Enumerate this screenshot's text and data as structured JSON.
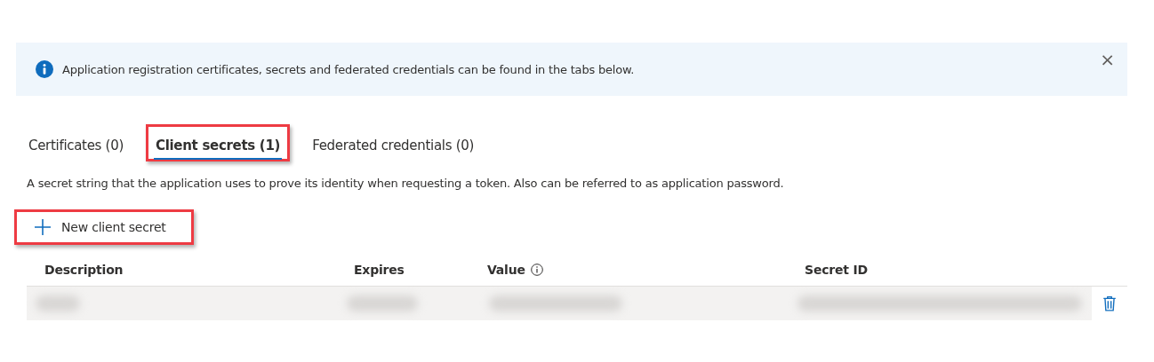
{
  "banner": {
    "message": "Application registration certificates, secrets and federated credentials can be found in the tabs below.",
    "close": "×"
  },
  "tabs": [
    {
      "label": "Certificates (0)",
      "selected": false,
      "highlighted": false
    },
    {
      "label": "Client secrets (1)",
      "selected": true,
      "highlighted": true
    },
    {
      "label": "Federated credentials (0)",
      "selected": false,
      "highlighted": false
    }
  ],
  "description": "A secret string that the application uses to prove its identity when requesting a token. Also can be referred to as application password.",
  "new_button": {
    "label": "New client secret",
    "highlighted": true
  },
  "table": {
    "columns": [
      {
        "label": "Description",
        "info": false
      },
      {
        "label": "Expires",
        "info": false
      },
      {
        "label": "Value",
        "info": true
      },
      {
        "label": "Secret ID",
        "info": false
      }
    ],
    "rows": [
      {
        "kind": "redacted"
      }
    ]
  }
}
